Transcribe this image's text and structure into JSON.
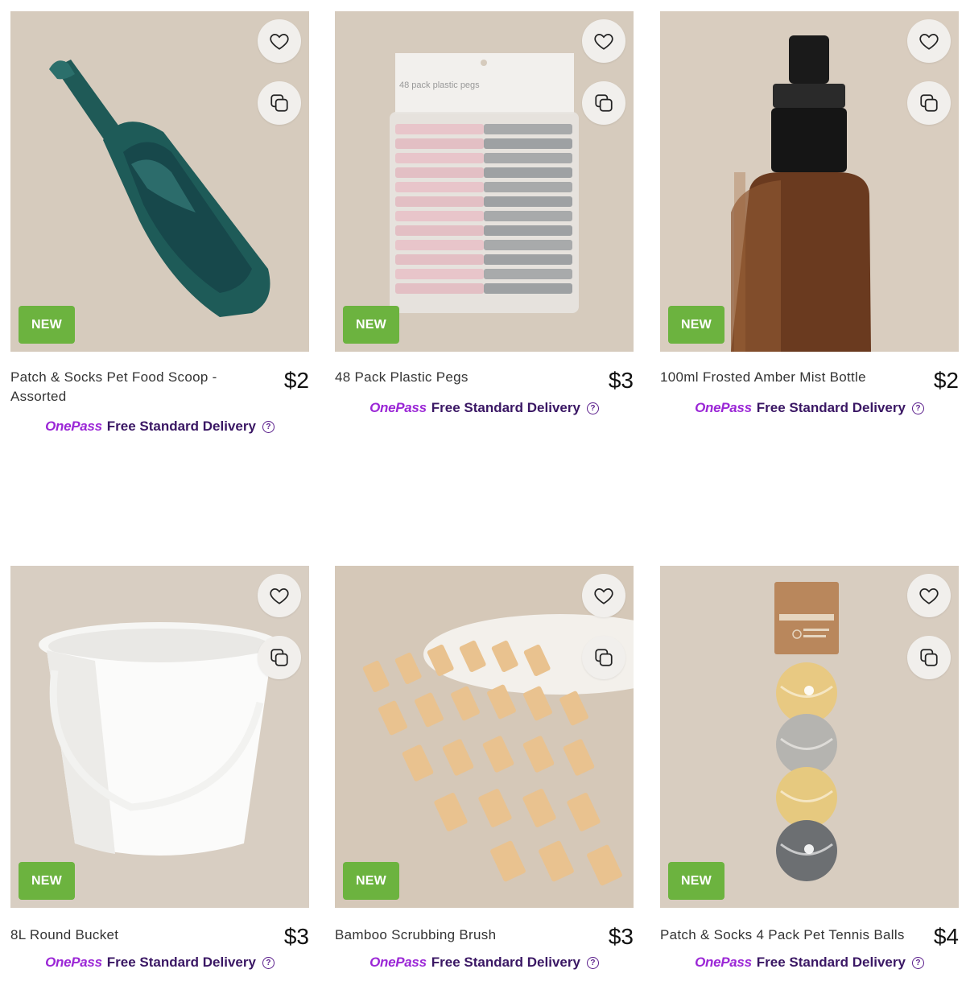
{
  "products": [
    {
      "title": "Patch & Socks Pet Food Scoop - Assorted",
      "price": "$2",
      "badge": "NEW",
      "image": "teal pet food scoop"
    },
    {
      "title": "48 Pack Plastic Pegs",
      "price": "$3",
      "badge": "NEW",
      "image": "pack of pink and grey plastic pegs",
      "image_label": "48 pack plastic pegs"
    },
    {
      "title": "100ml Frosted Amber Mist Bottle",
      "price": "$2",
      "badge": "NEW",
      "image": "amber spray bottle"
    },
    {
      "title": "8L Round Bucket",
      "price": "$3",
      "badge": "NEW",
      "image": "white bucket"
    },
    {
      "title": "Bamboo Scrubbing Brush",
      "price": "$3",
      "badge": "NEW",
      "image": "bamboo scrubbing brush bristles"
    },
    {
      "title": "Patch & Socks 4 Pack Pet Tennis Balls",
      "price": "$4",
      "badge": "NEW",
      "image": "four pet tennis balls in net"
    }
  ],
  "delivery": {
    "brand": "OnePass",
    "text": "Free Standard Delivery",
    "help_icon": "question-circle-icon"
  },
  "icons": {
    "favourite": "heart-icon",
    "compare": "compare-squares-icon"
  },
  "colors": {
    "badge": "#6cb33f",
    "onepass": "#9b27d6",
    "delivery_text": "#3a1764",
    "image_bg": "#d8cdbf"
  }
}
